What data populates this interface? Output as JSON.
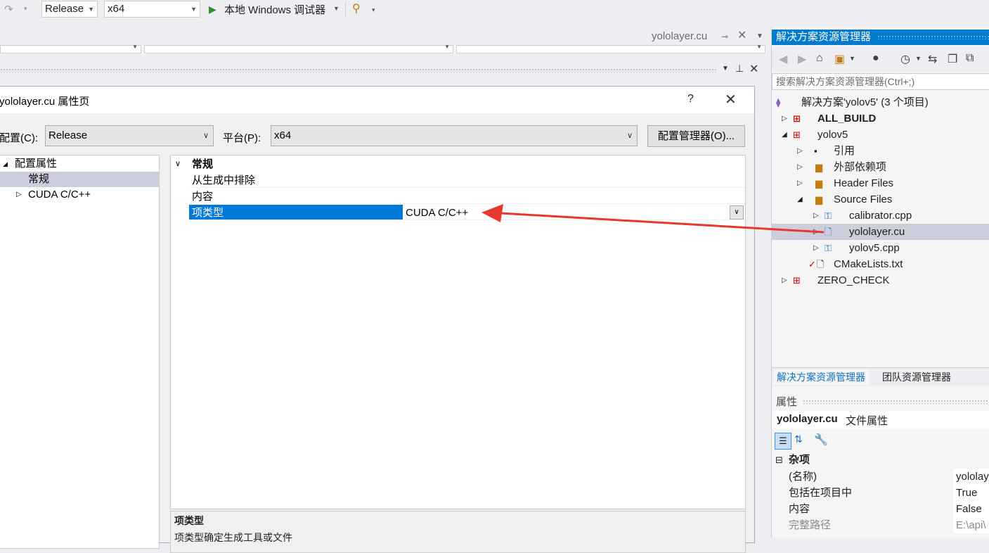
{
  "toolbar": {
    "config_value": "Release",
    "platform_value": "x64",
    "run_label": "本地 Windows 调试器"
  },
  "doc_tab": {
    "title": "yololayer.cu"
  },
  "dialog": {
    "title": "yololayer.cu 属性页",
    "help": "?",
    "config_label": "配置(C):",
    "config_value": "Release",
    "platform_label": "平台(P):",
    "platform_value": "x64",
    "config_manager_button": "配置管理器(O)...",
    "tree": [
      {
        "label": "配置属性",
        "expander": "◢"
      },
      {
        "label": "常规",
        "expander": ""
      },
      {
        "label": "CUDA C/C++",
        "expander": "▷"
      }
    ],
    "grid": {
      "category": "常规",
      "rows": [
        {
          "name": "从生成中排除",
          "value": ""
        },
        {
          "name": "内容",
          "value": ""
        },
        {
          "name": "项类型",
          "value": "CUDA C/C++"
        }
      ]
    },
    "description": {
      "title": "项类型",
      "text": "项类型确定生成工具或文件"
    }
  },
  "solution_explorer": {
    "title": "解决方案资源管理器",
    "search_placeholder": "搜索解决方案资源管理器(Ctrl+;)",
    "items": [
      {
        "label": "解决方案'yolov5' (3 个项目)"
      },
      {
        "label": "ALL_BUILD"
      },
      {
        "label": "yolov5"
      },
      {
        "label": "引用"
      },
      {
        "label": "外部依赖项"
      },
      {
        "label": "Header Files"
      },
      {
        "label": "Source Files"
      },
      {
        "label": "calibrator.cpp"
      },
      {
        "label": "yololayer.cu"
      },
      {
        "label": "yolov5.cpp"
      },
      {
        "label": "CMakeLists.txt"
      },
      {
        "label": "ZERO_CHECK"
      }
    ],
    "tabs": [
      "解决方案资源管理器",
      "团队资源管理器"
    ]
  },
  "properties": {
    "title": "属性",
    "object_name": "yololayer.cu",
    "object_type": "文件属性",
    "category": "杂项",
    "rows": [
      {
        "name": "(名称)",
        "value": "yololay"
      },
      {
        "name": "包括在项目中",
        "value": "True"
      },
      {
        "name": "内容",
        "value": "False"
      },
      {
        "name": "完整路径",
        "value": "E:\\api\\"
      }
    ]
  },
  "colors": {
    "accent": "#007acc",
    "selection": "#0078d7",
    "arrow": "#e8382e"
  }
}
